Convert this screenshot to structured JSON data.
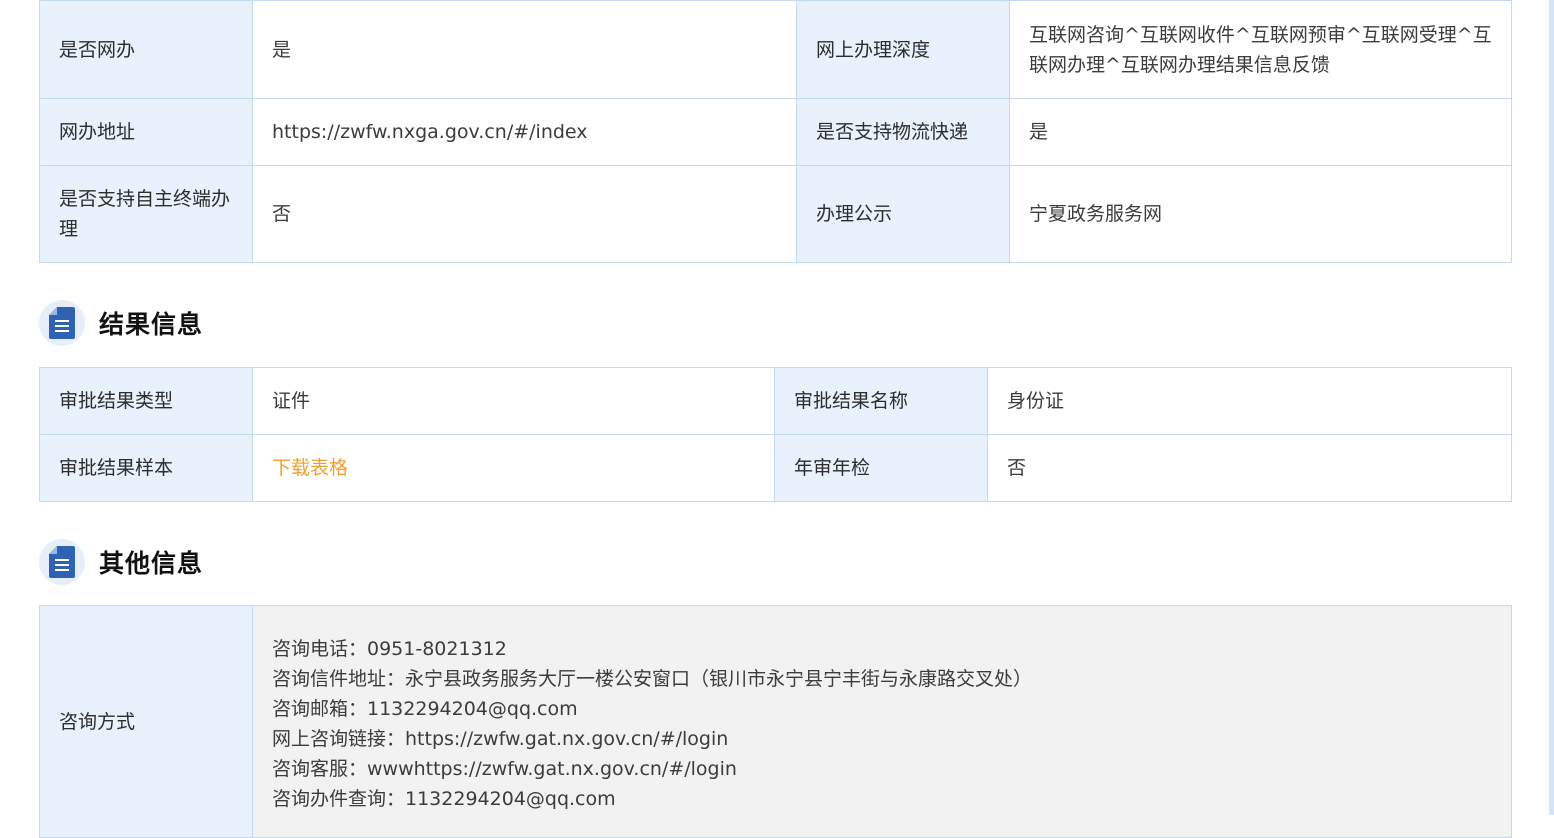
{
  "section_basic": {
    "rows": [
      {
        "l1": "是否网办",
        "v1": "是",
        "l2": "网上办理深度",
        "v2": "互联网咨询^互联网收件^互联网预审^互联网受理^互联网办理^互联网办理结果信息反馈"
      },
      {
        "l1": "网办地址",
        "v1": "https://zwfw.nxga.gov.cn/#/index",
        "l2": "是否支持物流快递",
        "v2": "是"
      },
      {
        "l1": "是否支持自主终端办理",
        "v1": "否",
        "l2": "办理公示",
        "v2": "宁夏政务服务网"
      }
    ]
  },
  "section_result": {
    "title": "结果信息",
    "icon": "document-icon",
    "rows": [
      {
        "l1": "审批结果类型",
        "v1": "证件",
        "l2": "审批结果名称",
        "v2": "身份证"
      },
      {
        "l1": "审批结果样本",
        "v1": "下载表格",
        "l2": "年审年检",
        "v2": "否"
      }
    ],
    "link_color": "#f0a030"
  },
  "section_other": {
    "title": "其他信息",
    "icon": "document-icon",
    "contact_label": "咨询方式",
    "contact_lines": [
      "咨询电话：0951-8021312",
      "咨询信件地址：永宁县政务服务大厅一楼公安窗口（银川市永宁县宁丰街与永康路交叉处）",
      "咨询邮箱：1132294204@qq.com",
      "网上咨询链接：https://zwfw.gat.nx.gov.cn/#/login",
      "咨询客服：wwwhttps://zwfw.gat.nx.gov.cn/#/login",
      "咨询办件查询：1132294204@qq.com"
    ]
  },
  "colors": {
    "label_bg": "#e8f1fc",
    "border": "#c4d9ef",
    "icon_blue": "#2f62b0",
    "link_orange": "#f0a030"
  }
}
